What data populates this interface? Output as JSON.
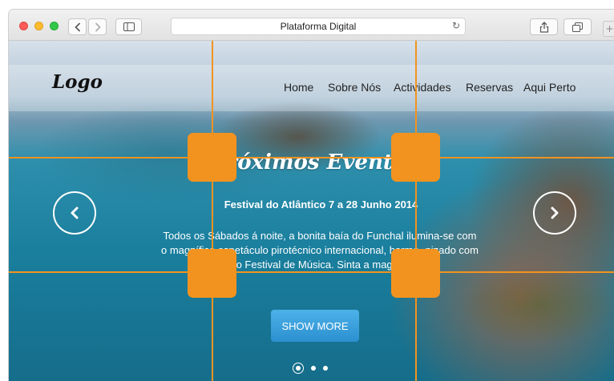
{
  "browser": {
    "url_title": "Plataforma Digital",
    "icons": {
      "back": "chevron-left",
      "forward": "chevron-right",
      "sidebar": "sidebar-toggle",
      "reload": "reload",
      "share": "share",
      "tabs": "tab-overview",
      "new_tab": "plus"
    }
  },
  "site": {
    "logo": "Logo",
    "nav": [
      "Home",
      "Sobre Nós",
      "Actividades",
      "Reservas",
      "Aqui Perto"
    ],
    "hero": {
      "title": "Próximos Eventos",
      "subtitle": "Festival do Atlântico 7 a 28 Junho 2014",
      "paragraph": "Todos os Sábados á noite, a bonita baía do Funchal ilumina-se com o magnífico espetáculo pirotécnico internacional, harmo- nizado com o Festival de Música. Sinta a magia!",
      "button": "SHOW MORE",
      "slides": 3,
      "active_slide": 1
    }
  },
  "overlay": {
    "color": "#f3931f",
    "guides": "3x3 grid lines with 4 square handles"
  }
}
